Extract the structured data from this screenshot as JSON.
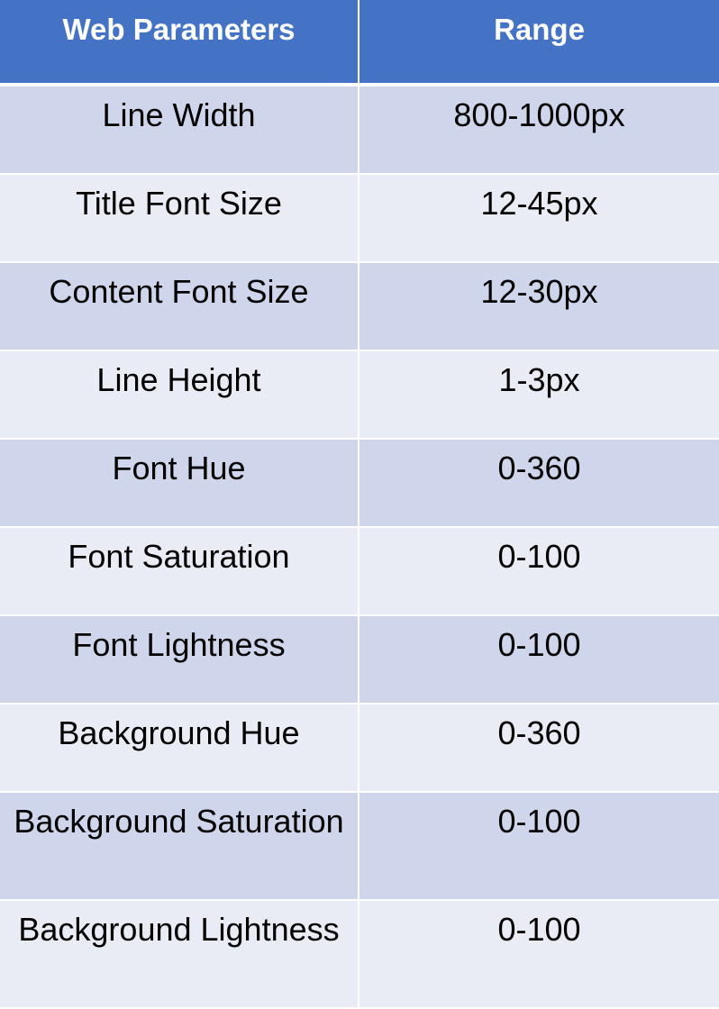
{
  "table": {
    "headers": {
      "parameter": "Web Parameters",
      "range": "Range"
    },
    "rows": [
      {
        "parameter": "Line Width",
        "range": "800-1000px"
      },
      {
        "parameter": "Title Font Size",
        "range": "12-45px"
      },
      {
        "parameter": "Content Font Size",
        "range": "12-30px"
      },
      {
        "parameter": "Line Height",
        "range": "1-3px"
      },
      {
        "parameter": "Font Hue",
        "range": "0-360"
      },
      {
        "parameter": "Font Saturation",
        "range": "0-100"
      },
      {
        "parameter": "Font Lightness",
        "range": "0-100"
      },
      {
        "parameter": "Background Hue",
        "range": "0-360"
      },
      {
        "parameter": "Background Saturation",
        "range": "0-100"
      },
      {
        "parameter": "Background Lightness",
        "range": "0-100"
      }
    ]
  },
  "colors": {
    "header_background": "#4472c4",
    "row_band_dark": "#cfd5ea",
    "row_band_light": "#e9ebf5",
    "header_text": "#ffffff",
    "body_text": "#000000"
  }
}
